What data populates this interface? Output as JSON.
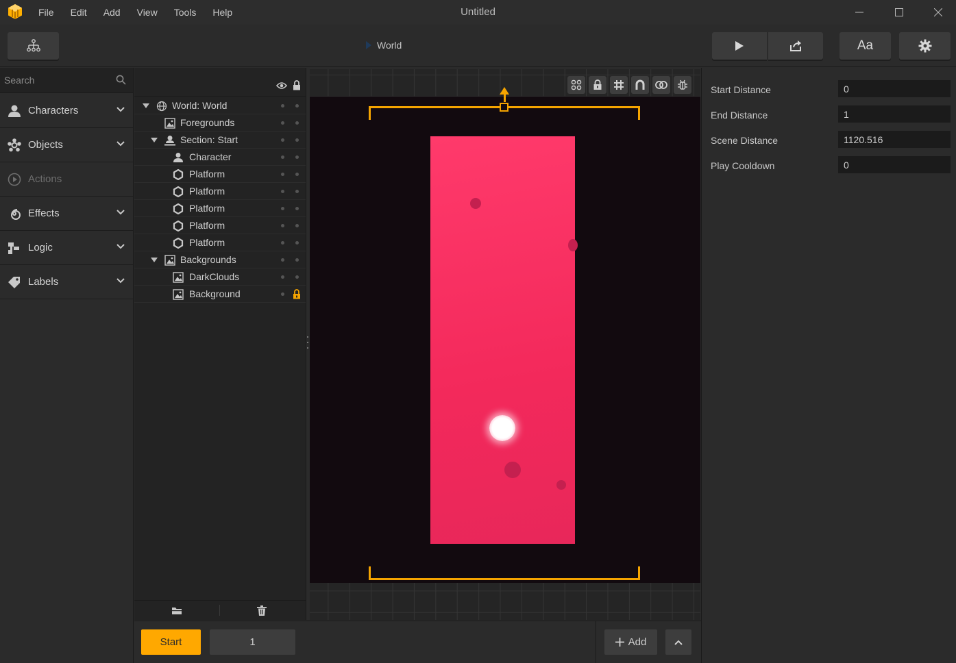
{
  "window": {
    "title": "Untitled"
  },
  "menu": [
    "File",
    "Edit",
    "Add",
    "View",
    "Tools",
    "Help"
  ],
  "toolbar": {
    "breadcrumb": "World",
    "font_button_label": "Aa"
  },
  "sidebar": {
    "search_placeholder": "Search",
    "categories": [
      {
        "label": "Characters",
        "icon": "person-icon",
        "enabled": true
      },
      {
        "label": "Objects",
        "icon": "objects-icon",
        "enabled": true
      },
      {
        "label": "Actions",
        "icon": "play-circle-icon",
        "enabled": false
      },
      {
        "label": "Effects",
        "icon": "spiral-icon",
        "enabled": true
      },
      {
        "label": "Logic",
        "icon": "logic-icon",
        "enabled": true
      },
      {
        "label": "Labels",
        "icon": "tag-icon",
        "enabled": true
      }
    ]
  },
  "hierarchy": {
    "items": [
      {
        "label": "World: World",
        "icon": "globe-icon",
        "expanded": true
      },
      {
        "label": "Foregrounds",
        "icon": "image-icon"
      },
      {
        "label": "Section: Start",
        "icon": "section-icon",
        "expanded": true
      },
      {
        "label": "Character",
        "icon": "person-icon"
      },
      {
        "label": "Platform",
        "icon": "hexagon-icon"
      },
      {
        "label": "Platform",
        "icon": "hexagon-icon"
      },
      {
        "label": "Platform",
        "icon": "hexagon-icon"
      },
      {
        "label": "Platform",
        "icon": "hexagon-icon"
      },
      {
        "label": "Platform",
        "icon": "hexagon-icon"
      },
      {
        "label": "Backgrounds",
        "icon": "image-icon",
        "expanded": true
      },
      {
        "label": "DarkClouds",
        "icon": "image-icon"
      },
      {
        "label": "Background",
        "icon": "image-icon",
        "locked": true
      }
    ]
  },
  "properties": [
    {
      "label": "Start Distance",
      "value": "0"
    },
    {
      "label": "End Distance",
      "value": "1"
    },
    {
      "label": "Scene Distance",
      "value": "1120.516"
    },
    {
      "label": "Play Cooldown",
      "value": "0"
    }
  ],
  "bottombar": {
    "section_label": "Start",
    "section_number": "1",
    "add_label": "Add"
  },
  "colors": {
    "accent": "#ffa800",
    "scene_pink": "#f3295b",
    "scene_bg": "#120a0f"
  }
}
